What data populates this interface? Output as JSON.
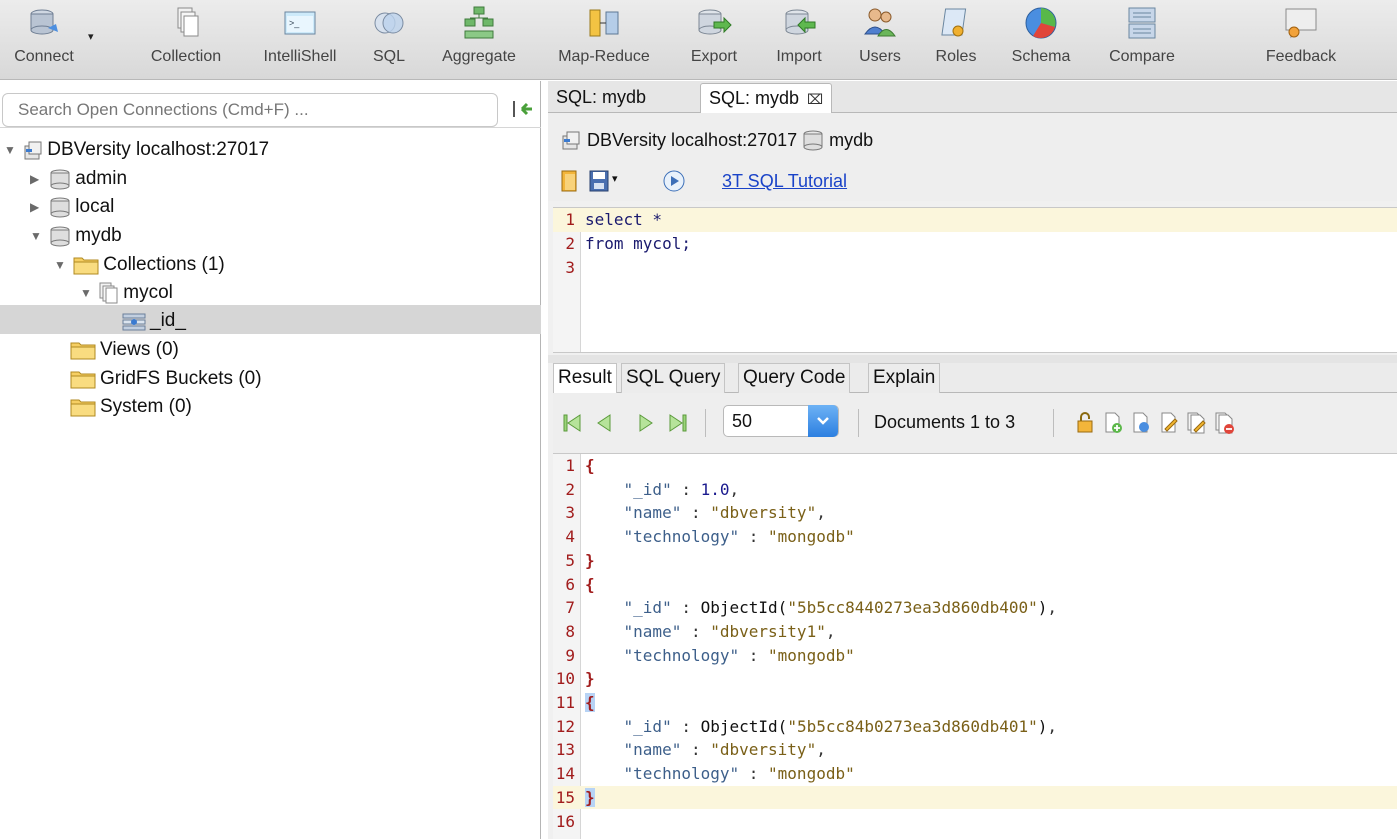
{
  "toolbar": {
    "buttons": [
      {
        "label": "Connect",
        "icon": "connect-icon"
      },
      {
        "label": "Collection",
        "icon": "collection-icon"
      },
      {
        "label": "IntelliShell",
        "icon": "intellishell-icon"
      },
      {
        "label": "SQL",
        "icon": "sql-icon"
      },
      {
        "label": "Aggregate",
        "icon": "aggregate-icon"
      },
      {
        "label": "Map-Reduce",
        "icon": "map-reduce-icon"
      },
      {
        "label": "Export",
        "icon": "export-icon"
      },
      {
        "label": "Import",
        "icon": "import-icon"
      },
      {
        "label": "Users",
        "icon": "users-icon"
      },
      {
        "label": "Roles",
        "icon": "roles-icon"
      },
      {
        "label": "Schema",
        "icon": "schema-icon"
      },
      {
        "label": "Compare",
        "icon": "compare-icon"
      },
      {
        "label": "Feedback",
        "icon": "feedback-icon"
      }
    ],
    "dropdown_arrow": "▾"
  },
  "search": {
    "placeholder": "Search Open Connections (Cmd+F) ..."
  },
  "tree": {
    "connection": "DBVersity localhost:27017",
    "databases": [
      "admin",
      "local",
      "mydb"
    ],
    "collections_folder": "Collections (1)",
    "collection": "mycol",
    "index": "_id_",
    "views": "Views (0)",
    "gridfs": "GridFS Buckets (0)",
    "system": "System (0)"
  },
  "tabs": [
    {
      "label": "SQL: mydb",
      "active": false
    },
    {
      "label": "SQL: mydb",
      "active": true,
      "close": "⌧"
    }
  ],
  "query_header": {
    "connection": "DBVersity localhost:27017",
    "database": "mydb",
    "tutorial_link": "3T SQL Tutorial"
  },
  "sql_editor": {
    "lines": [
      {
        "n": "1",
        "code": "select *"
      },
      {
        "n": "2",
        "code": "from mycol;"
      },
      {
        "n": "3",
        "code": ""
      }
    ]
  },
  "result_tabs": [
    "Result",
    "SQL Query",
    "Query Code",
    "Explain"
  ],
  "result_toolbar": {
    "page_size": "50",
    "doc_count": "Documents 1 to 3"
  },
  "result_lines": [
    {
      "n": "1",
      "html": "{"
    },
    {
      "n": "2",
      "key": "\"_id\"",
      "sep": " : ",
      "val": "1.0",
      "kind": "num",
      "comma": ","
    },
    {
      "n": "3",
      "key": "\"name\"",
      "sep": " : ",
      "val": "\"dbversity\"",
      "kind": "str",
      "comma": ","
    },
    {
      "n": "4",
      "key": "\"technology\"",
      "sep": " : ",
      "val": "\"mongodb\"",
      "kind": "str",
      "comma": ""
    },
    {
      "n": "5",
      "html": "}"
    },
    {
      "n": "6",
      "html": "{"
    },
    {
      "n": "7",
      "key": "\"_id\"",
      "sep": " : ",
      "fn": "ObjectId(",
      "val": "\"5b5cc8440273ea3d860db400\"",
      "kind": "str",
      "fnclose": ")",
      "comma": ","
    },
    {
      "n": "8",
      "key": "\"name\"",
      "sep": " : ",
      "val": "\"dbversity1\"",
      "kind": "str",
      "comma": ","
    },
    {
      "n": "9",
      "key": "\"technology\"",
      "sep": " : ",
      "val": "\"mongodb\"",
      "kind": "str",
      "comma": ""
    },
    {
      "n": "10",
      "html": "}"
    },
    {
      "n": "11",
      "html": "{"
    },
    {
      "n": "12",
      "key": "\"_id\"",
      "sep": " : ",
      "fn": "ObjectId(",
      "val": "\"5b5cc84b0273ea3d860db401\"",
      "kind": "str",
      "fnclose": ")",
      "comma": ","
    },
    {
      "n": "13",
      "key": "\"name\"",
      "sep": " : ",
      "val": "\"dbversity\"",
      "kind": "str",
      "comma": ","
    },
    {
      "n": "14",
      "key": "\"technology\"",
      "sep": " : ",
      "val": "\"mongodb\"",
      "kind": "str",
      "comma": ""
    },
    {
      "n": "15",
      "html": "}"
    },
    {
      "n": "16",
      "html": ""
    }
  ],
  "colors": {
    "line_number": "#a11c1c",
    "current_line": "#fbf6dc",
    "link": "#1a43c8",
    "selection": "#d6d6d6"
  }
}
